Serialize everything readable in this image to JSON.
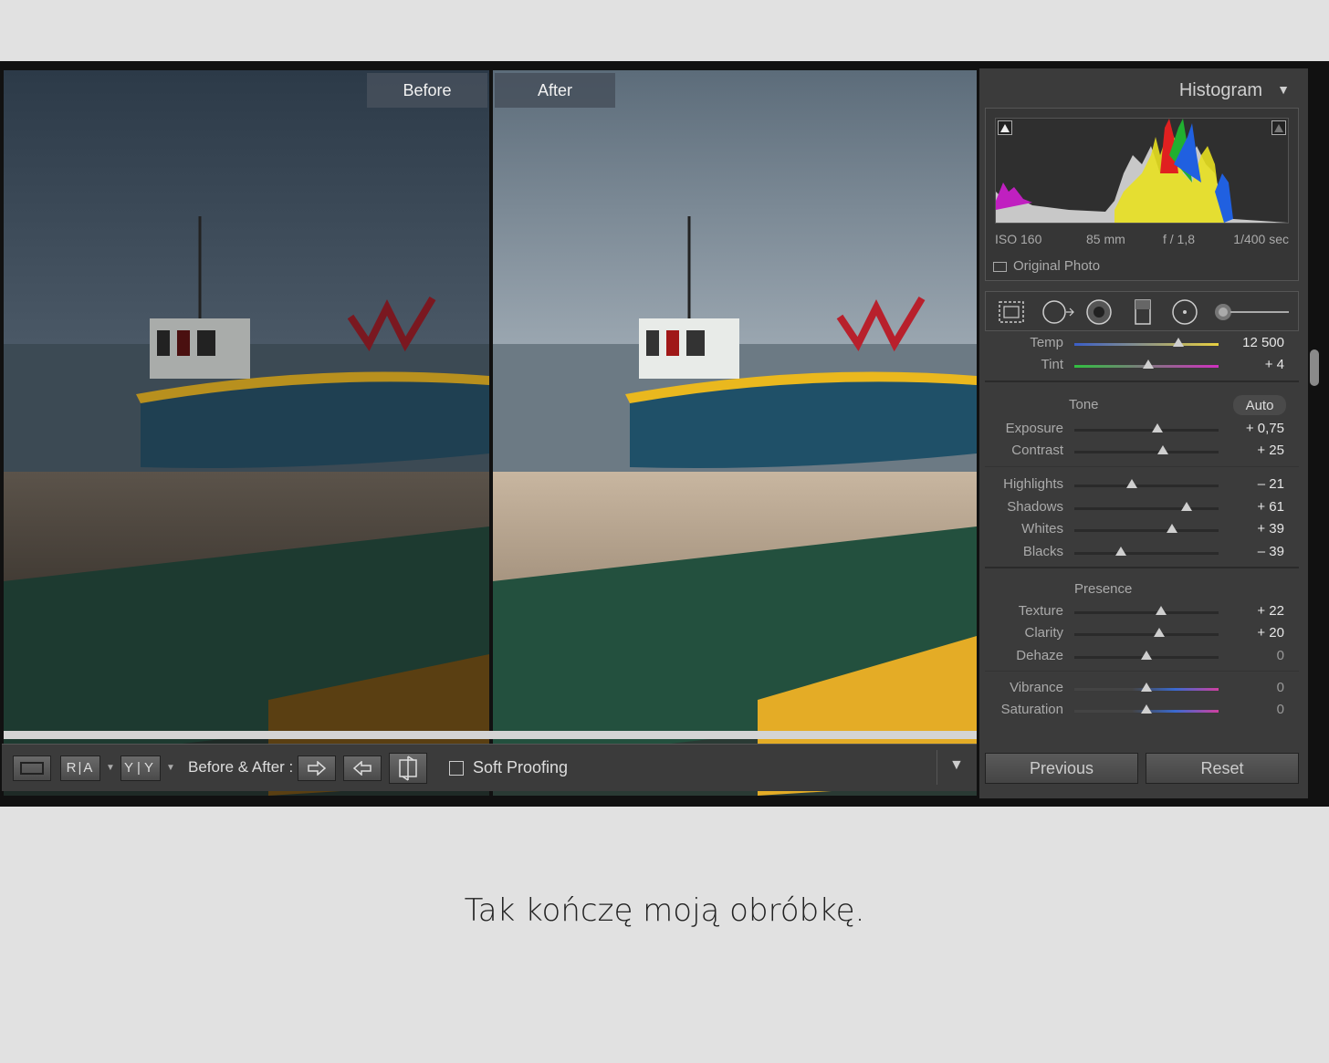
{
  "panes": {
    "before_label": "Before",
    "after_label": "After"
  },
  "toolbar": {
    "ra_label": "R|A",
    "yy_label": "Y|Y",
    "before_after_label": "Before & After :",
    "soft_proofing_label": "Soft Proofing"
  },
  "panel": {
    "histogram_title": "Histogram",
    "exif": {
      "iso": "ISO 160",
      "focal": "85 mm",
      "aperture": "f / 1,8",
      "shutter": "1/400 sec"
    },
    "original_photo_label": "Original Photo",
    "basic": {
      "temp": {
        "label": "Temp",
        "value": "12 500",
        "level": 0.72
      },
      "tint": {
        "label": "Tint",
        "value": "+ 4",
        "level": 0.51
      },
      "tone_title": "Tone",
      "auto_label": "Auto",
      "exposure": {
        "label": "Exposure",
        "value": "+ 0,75",
        "level": 0.575
      },
      "contrast": {
        "label": "Contrast",
        "value": "+ 25",
        "level": 0.615
      },
      "highlights": {
        "label": "Highlights",
        "value": "– 21",
        "level": 0.4
      },
      "shadows": {
        "label": "Shadows",
        "value": "+ 61",
        "level": 0.78
      },
      "whites": {
        "label": "Whites",
        "value": "+ 39",
        "level": 0.68
      },
      "blacks": {
        "label": "Blacks",
        "value": "– 39",
        "level": 0.32
      },
      "presence_title": "Presence",
      "texture": {
        "label": "Texture",
        "value": "+ 22",
        "level": 0.6
      },
      "clarity": {
        "label": "Clarity",
        "value": "+ 20",
        "level": 0.59
      },
      "dehaze": {
        "label": "Dehaze",
        "value": "0",
        "level": 0.5
      },
      "vibrance": {
        "label": "Vibrance",
        "value": "0",
        "level": 0.5
      },
      "saturation": {
        "label": "Saturation",
        "value": "0",
        "level": 0.5
      }
    },
    "previous_label": "Previous",
    "reset_label": "Reset"
  },
  "caption": "Tak kończę moją obróbkę.",
  "colors": {
    "app_bg": "#111111",
    "panel_bg": "#3b3b3b",
    "page_bg": "#e1e1e1"
  }
}
